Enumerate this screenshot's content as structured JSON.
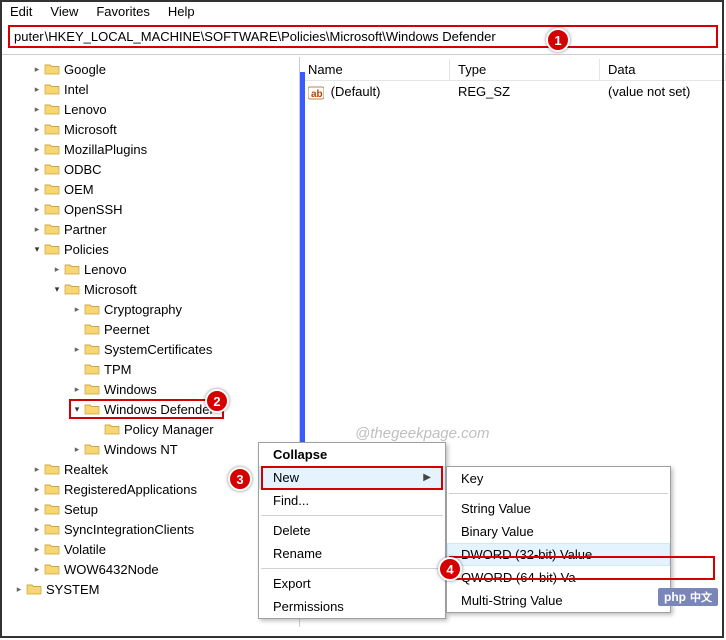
{
  "menu": {
    "edit": "Edit",
    "view": "View",
    "favorites": "Favorites",
    "help": "Help"
  },
  "path": {
    "prefix": "puter",
    "value": "\\HKEY_LOCAL_MACHINE\\SOFTWARE\\Policies\\Microsoft\\Windows Defender"
  },
  "tree": [
    {
      "indent": 0,
      "exp": ">",
      "label": "Google"
    },
    {
      "indent": 0,
      "exp": ">",
      "label": "Intel"
    },
    {
      "indent": 0,
      "exp": ">",
      "label": "Lenovo"
    },
    {
      "indent": 0,
      "exp": ">",
      "label": "Microsoft"
    },
    {
      "indent": 0,
      "exp": ">",
      "label": "MozillaPlugins"
    },
    {
      "indent": 0,
      "exp": ">",
      "label": "ODBC"
    },
    {
      "indent": 0,
      "exp": ">",
      "label": "OEM"
    },
    {
      "indent": 0,
      "exp": ">",
      "label": "OpenSSH"
    },
    {
      "indent": 0,
      "exp": ">",
      "label": "Partner"
    },
    {
      "indent": 0,
      "exp": "v",
      "label": "Policies"
    },
    {
      "indent": 1,
      "exp": ">",
      "label": "Lenovo"
    },
    {
      "indent": 1,
      "exp": "v",
      "label": "Microsoft"
    },
    {
      "indent": 2,
      "exp": ">",
      "label": "Cryptography"
    },
    {
      "indent": 2,
      "exp": "",
      "label": "Peernet"
    },
    {
      "indent": 2,
      "exp": ">",
      "label": "SystemCertificates"
    },
    {
      "indent": 2,
      "exp": "",
      "label": "TPM"
    },
    {
      "indent": 2,
      "exp": ">",
      "label": "Windows"
    },
    {
      "indent": 2,
      "exp": "v",
      "label": "Windows Defender",
      "hl": true
    },
    {
      "indent": 3,
      "exp": "",
      "label": "Policy Manager"
    },
    {
      "indent": 2,
      "exp": ">",
      "label": "Windows NT"
    },
    {
      "indent": 0,
      "exp": ">",
      "label": "Realtek"
    },
    {
      "indent": 0,
      "exp": ">",
      "label": "RegisteredApplications"
    },
    {
      "indent": 0,
      "exp": ">",
      "label": "Setup"
    },
    {
      "indent": 0,
      "exp": ">",
      "label": "SyncIntegrationClients"
    },
    {
      "indent": 0,
      "exp": ">",
      "label": "Volatile"
    },
    {
      "indent": 0,
      "exp": ">",
      "label": "WOW6432Node"
    },
    {
      "indent": -1,
      "exp": ">",
      "label": "SYSTEM",
      "half": true
    }
  ],
  "list": {
    "headers": {
      "name": "Name",
      "type": "Type",
      "data": "Data"
    },
    "rows": [
      {
        "name": "(Default)",
        "type": "REG_SZ",
        "data": "(value not set)"
      }
    ]
  },
  "ctx1": {
    "collapse": "Collapse",
    "new": "New",
    "find": "Find...",
    "delete": "Delete",
    "rename": "Rename",
    "export": "Export",
    "permissions": "Permissions"
  },
  "ctx2": {
    "key": "Key",
    "string": "String Value",
    "binary": "Binary Value",
    "dword": "DWORD (32-bit) Value",
    "qword": "QWORD (64-bit) Va",
    "multi": "Multi-String Value"
  },
  "callouts": {
    "c1": "1",
    "c2": "2",
    "c3": "3",
    "c4": "4"
  },
  "watermark": "@thegeekpage.com",
  "badge": {
    "php": "php",
    "cn": "中文"
  }
}
